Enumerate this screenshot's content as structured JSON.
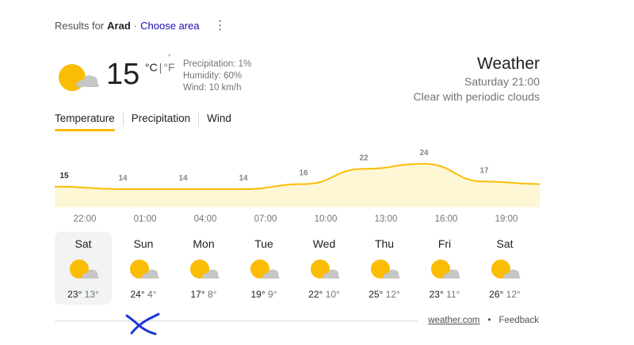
{
  "results": {
    "prefix": "Results for",
    "place": "Arad",
    "separator": "·",
    "choose_area": "Choose area",
    "more_icon": "⋮"
  },
  "current": {
    "temp": "15",
    "unit_c": "°C",
    "unit_divider": "|",
    "unit_f": "°F",
    "unit_dot": "°",
    "icon": "partly-cloudy-icon",
    "precipitation": "Precipitation: 1%",
    "humidity": "Humidity: 60%",
    "wind": "Wind: 10 km/h"
  },
  "header": {
    "title": "Weather",
    "datetime": "Saturday 21:00",
    "condition": "Clear with periodic clouds"
  },
  "tabs": [
    {
      "label": "Temperature",
      "active": true
    },
    {
      "label": "Precipitation",
      "active": false
    },
    {
      "label": "Wind",
      "active": false
    }
  ],
  "colors": {
    "accent": "#fbbc04",
    "chart_fill": "#fef7d6",
    "sun": "#fbbc04",
    "cloud": "#c6c6c6",
    "link": "#1a0dab",
    "scribble": "#1a36d6"
  },
  "chart_data": {
    "type": "area",
    "x": [
      "22:00",
      "01:00",
      "04:00",
      "07:00",
      "10:00",
      "13:00",
      "16:00",
      "19:00"
    ],
    "values": [
      15,
      14,
      14,
      14,
      16,
      22,
      24,
      17
    ]
  },
  "forecast": [
    {
      "day": "Sat",
      "high": "23°",
      "low": "13°",
      "icon": "partly-cloudy-icon",
      "selected": true
    },
    {
      "day": "Sun",
      "high": "24°",
      "low": "4°",
      "icon": "partly-cloudy-icon",
      "selected": false
    },
    {
      "day": "Mon",
      "high": "17°",
      "low": "8°",
      "icon": "partly-cloudy-icon",
      "selected": false
    },
    {
      "day": "Tue",
      "high": "19°",
      "low": "9°",
      "icon": "partly-cloudy-icon",
      "selected": false
    },
    {
      "day": "Wed",
      "high": "22°",
      "low": "10°",
      "icon": "partly-cloudy-icon",
      "selected": false
    },
    {
      "day": "Thu",
      "high": "25°",
      "low": "12°",
      "icon": "partly-cloudy-icon",
      "selected": false
    },
    {
      "day": "Fri",
      "high": "23°",
      "low": "11°",
      "icon": "partly-cloudy-icon",
      "selected": false
    },
    {
      "day": "Sat",
      "high": "26°",
      "low": "12°",
      "icon": "partly-cloudy-icon",
      "selected": false
    }
  ],
  "footer": {
    "source": "weather.com",
    "bullet": "•",
    "feedback": "Feedback"
  }
}
